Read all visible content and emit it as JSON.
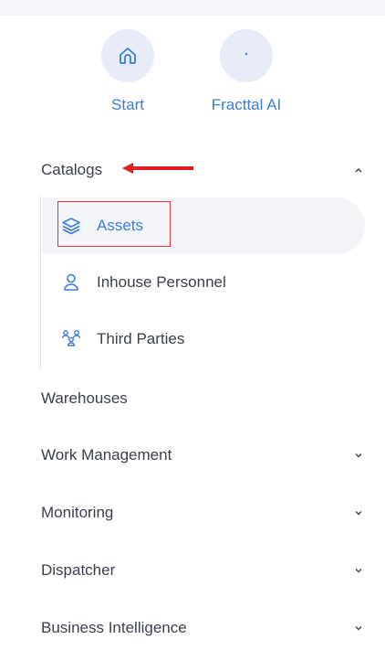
{
  "quick_access": [
    {
      "label": "Start",
      "icon": "home-icon"
    },
    {
      "label": "Fracttal AI",
      "icon": "sparkle-icon"
    }
  ],
  "catalogs": {
    "label": "Catalogs",
    "expanded": true,
    "items": [
      {
        "label": "Assets",
        "icon": "layers-icon",
        "active": true
      },
      {
        "label": "Inhouse Personnel",
        "icon": "person-icon"
      },
      {
        "label": "Third Parties",
        "icon": "group-icon"
      }
    ]
  },
  "sections": [
    {
      "label": "Warehouses",
      "has_chevron": false
    },
    {
      "label": "Work Management",
      "has_chevron": true
    },
    {
      "label": "Monitoring",
      "has_chevron": true
    },
    {
      "label": "Dispatcher",
      "has_chevron": true
    },
    {
      "label": "Business Intelligence",
      "has_chevron": true
    }
  ],
  "colors": {
    "accent": "#3b7ddd",
    "highlight": "#e0313a",
    "active_bg": "#f3f4f8"
  }
}
